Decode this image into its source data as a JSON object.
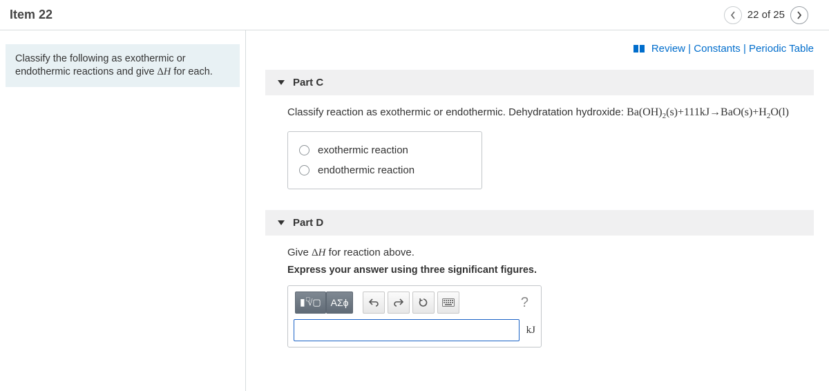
{
  "header": {
    "item_title": "Item 22",
    "position": "22 of 25"
  },
  "toolbar": {
    "review": "Review",
    "constants": "Constants",
    "periodic": "Periodic Table"
  },
  "instruction": {
    "text_before_dh": "Classify the following as exothermic or endothermic reactions and give ",
    "dh": "ΔH",
    "text_after_dh": " for each."
  },
  "partC": {
    "title": "Part C",
    "prompt_prefix": "Classify reaction as exothermic or endothermic. Dehydratation hydroxide: ",
    "equation_plain": "Ba(OH)2(s)+111kJ→BaO(s)+H2O(l)",
    "option1": "exothermic reaction",
    "option2": "endothermic reaction"
  },
  "partD": {
    "title": "Part D",
    "prompt_prefix": "Give ",
    "dh": "ΔH",
    "prompt_suffix": " for reaction above.",
    "instruction": "Express your answer using three significant figures.",
    "greek_btn": "ΑΣϕ",
    "help_btn": "?",
    "unit": "kJ",
    "input_value": ""
  }
}
